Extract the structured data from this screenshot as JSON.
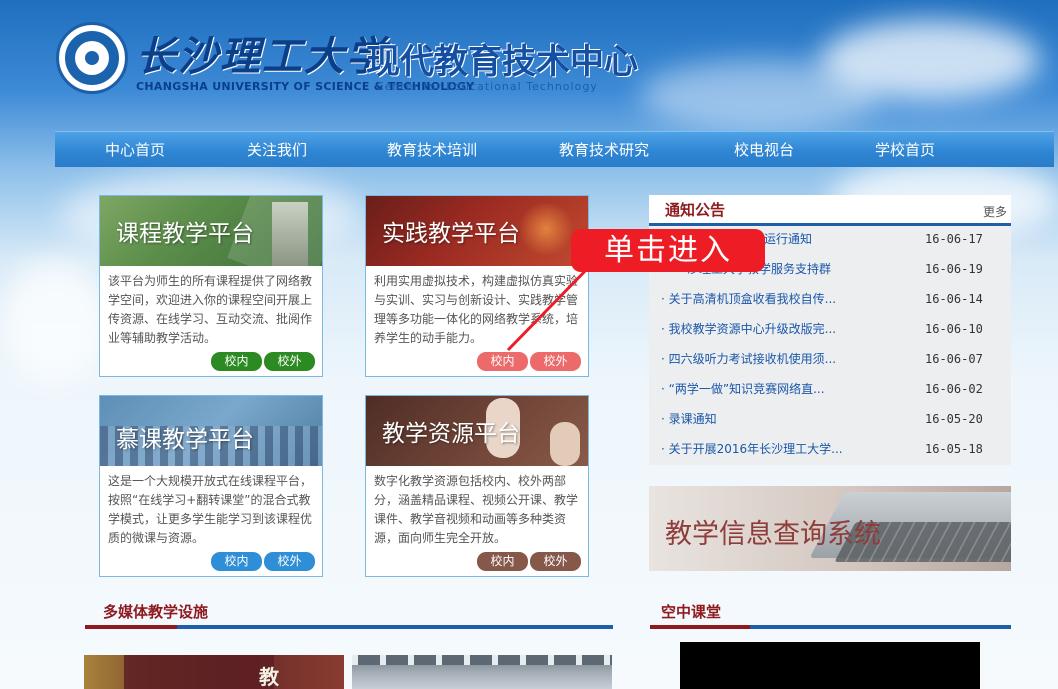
{
  "header": {
    "brand_cn": "长沙理工大学",
    "center_cn": "现代教育技术中心",
    "brand_en": "CHANGSHA UNIVERSITY OF SCIENCE & TECHNOLOGY",
    "center_en": "Center for Educational Technology"
  },
  "nav": {
    "items": [
      {
        "label": "中心首页"
      },
      {
        "label": "关注我们"
      },
      {
        "label": "教育技术培训"
      },
      {
        "label": "教育技术研究"
      },
      {
        "label": "校电视台"
      },
      {
        "label": "学校首页"
      }
    ]
  },
  "platforms": [
    {
      "title": "课程教学平台",
      "desc": "该平台为师生的所有课程提供了网络教学空间，欢迎进入你的课程空间开展上传资源、在线学习、互动交流、批阅作业等辅助教学活动。",
      "btn_in": "校内",
      "btn_out": "校外",
      "btn_color": "#2c8a22"
    },
    {
      "title": "实践教学平台",
      "desc": "利用实用虚拟技术，构建虚拟仿真实验与实训、实习与创新设计、实践教学管理等多功能一体化的网络教学系统，培养学生的动手能力。",
      "btn_in": "校内",
      "btn_out": "校外",
      "btn_color": "#ec6a6a"
    },
    {
      "title": "慕课教学平台",
      "desc": "这是一个大规模开放式在线课程平台，按照“在线学习+翻转课堂”的混合式教学模式，让更多学生能学习到该课程优质的微课与资源。",
      "btn_in": "校内",
      "btn_out": "校外",
      "btn_color": "#2f8fd6"
    },
    {
      "title": "教学资源平台",
      "desc": "数字化教学资源包括校内、校外两部分，涵盖精品课程、视频公开课、教学课件、教学音视频和动画等多种类资源，面向师生完全开放。",
      "btn_in": "校内",
      "btn_out": "校外",
      "btn_color": "#85584a"
    }
  ],
  "callout": {
    "text": "单击进入"
  },
  "notice": {
    "title": "通知公告",
    "more": "更多",
    "items": [
      {
        "text": "运行通知",
        "date": "16-06-17"
      },
      {
        "text": "沙理工大学教学服务支持群",
        "date": "16-06-19"
      },
      {
        "text": "关于高清机顶盒收看我校自传...",
        "date": "16-06-14"
      },
      {
        "text": "我校教学资源中心升级改版完...",
        "date": "16-06-10"
      },
      {
        "text": "四六级听力考试接收机使用须...",
        "date": "16-06-07"
      },
      {
        "text": "“两学一做”知识竞赛网络直...",
        "date": "16-06-02"
      },
      {
        "text": "录课通知",
        "date": "16-05-20"
      },
      {
        "text": "关于开展2016年长沙理工大学...",
        "date": "16-05-18"
      }
    ]
  },
  "info_banner": {
    "text": "教学信息查询系统"
  },
  "sections": {
    "multimedia": "多媒体教学设施",
    "sky_class": "空中课堂"
  },
  "photo_sign": {
    "text": "教"
  }
}
